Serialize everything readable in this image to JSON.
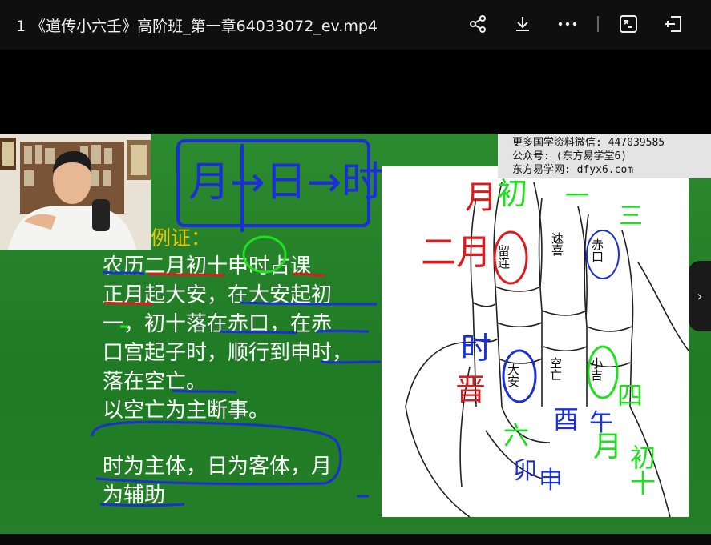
{
  "window": {
    "title": "1 《道传小六壬》高阶班_第一章64033072_ev.mp4"
  },
  "toolbar": {
    "share_icon": "share-icon",
    "download_icon": "download-icon",
    "more_icon": "more-icon",
    "screen_icon": "cast-screen-icon",
    "popout_icon": "pip-exit-icon"
  },
  "slide": {
    "example_title": "例证：",
    "lines": [
      "农历二月初十申时占课",
      "正月起大安，在大安起初",
      "一，初十落在赤口，在赤",
      "口宫起子时，顺行到申时，",
      "落在空亡。",
      "以空亡为主断事。",
      "时为主体，日为客体，月",
      "为辅助"
    ],
    "watermark": [
      "更多国学资料微信: 447039585",
      "公众号: (东方易学堂6)",
      "东方易学网: dfyx6.com"
    ],
    "palm_labels": [
      "留连",
      "速喜",
      "赤口",
      "大安",
      "空亡",
      "小吉"
    ],
    "annotations": {
      "top_chain": "月→日→时",
      "month": "月",
      "second_month": "二月",
      "chu": "初",
      "one": "一",
      "two": "二",
      "hour": "时",
      "jin": "晋",
      "chu_mid": "初",
      "chu_bottom_left": "六",
      "right_top": "三",
      "right_chu": "初十",
      "chu_4": "四",
      "mao": "卯",
      "you_chen": "酉",
      "wu": "午",
      "yue": "月",
      "shen": "申",
      "dash": "一"
    }
  },
  "colors": {
    "slide_green": "#2c8a2f",
    "accent_yellow": "#f5c400",
    "ink_blue": "#1a2fd6",
    "ink_red": "#e0191c",
    "ink_green": "#1fe01f"
  }
}
